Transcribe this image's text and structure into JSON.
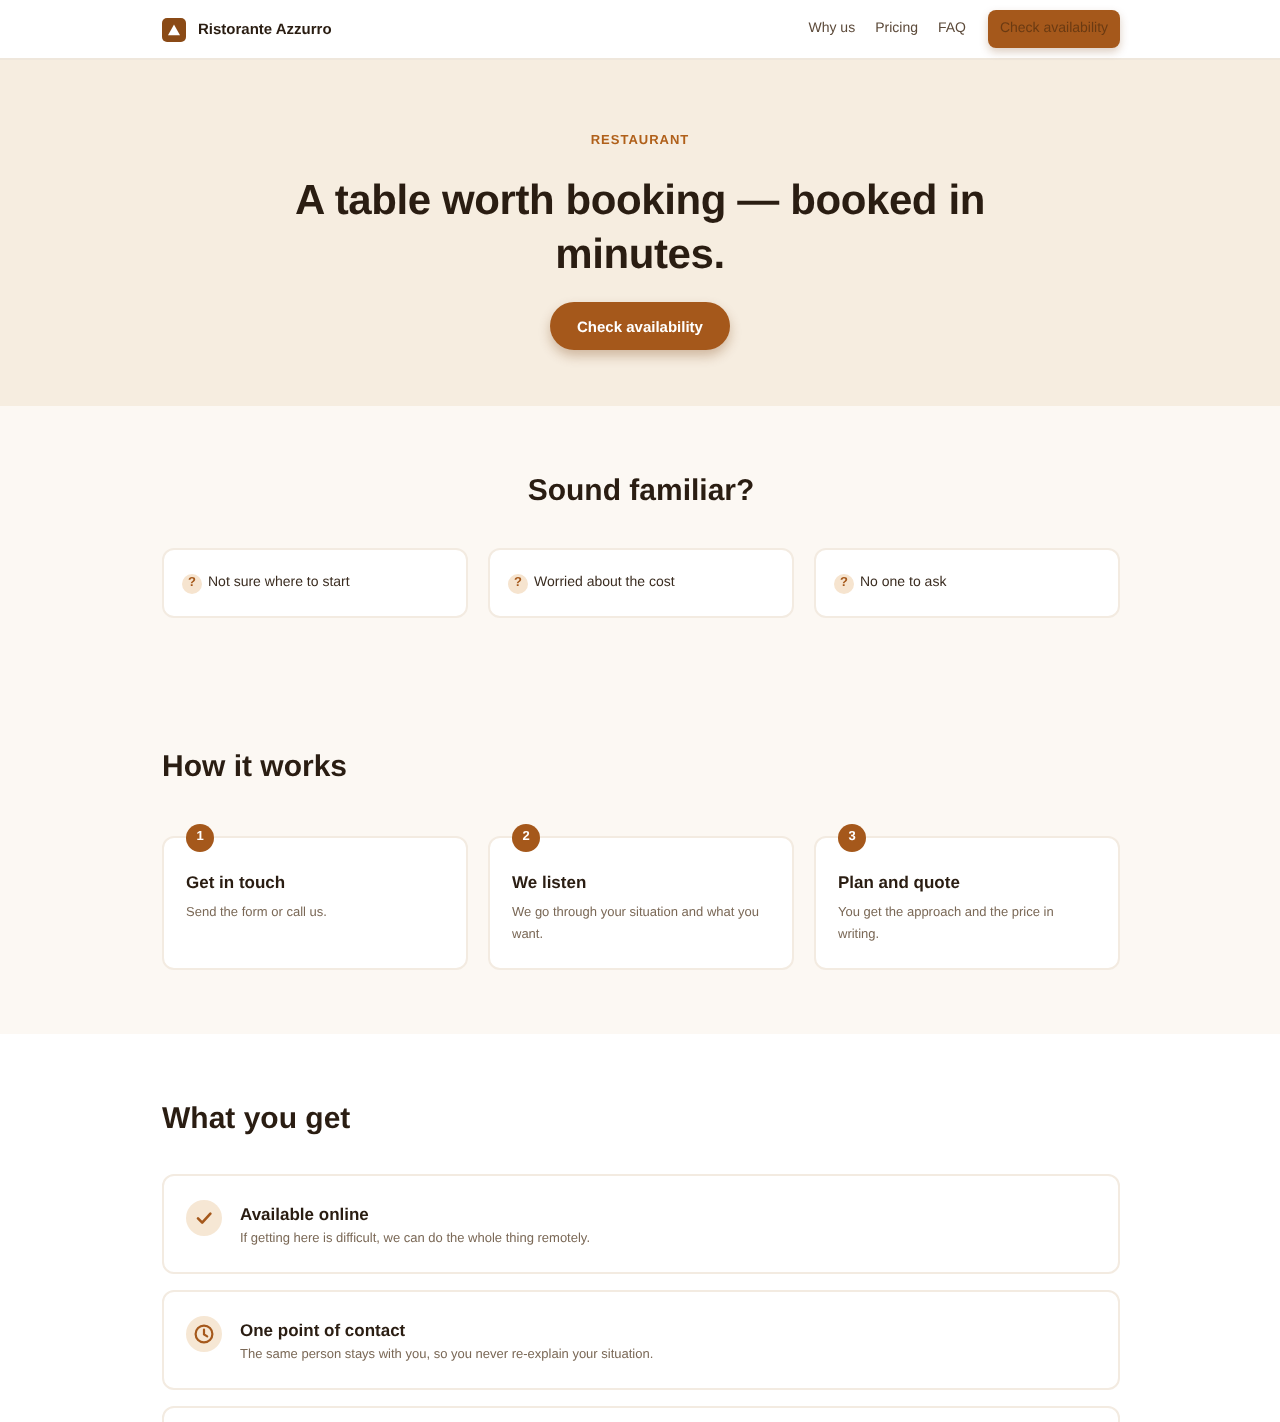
{
  "header": {
    "brand": "Ristorante Azzurro",
    "nav": [
      "Why us",
      "Pricing",
      "FAQ"
    ],
    "cta": "Check availability"
  },
  "hero": {
    "kicker": "RESTAURANT",
    "title": "A table worth booking — booked in minutes.",
    "button": "Check availability"
  },
  "pains": {
    "title": "Sound familiar?",
    "items": [
      {
        "icon": "?",
        "text": "Not sure where to start"
      },
      {
        "icon": "?",
        "text": "Worried about the cost"
      },
      {
        "icon": "?",
        "text": "No one to ask"
      }
    ]
  },
  "steps": {
    "title": "How it works",
    "items": [
      {
        "number": "1",
        "title": "Get in touch",
        "text": "Send the form or call us."
      },
      {
        "number": "2",
        "title": "We listen",
        "text": "We go through your situation and what you want."
      },
      {
        "number": "3",
        "title": "Plan and quote",
        "text": "You get the approach and the price in writing."
      }
    ]
  },
  "benefits": {
    "title": "What you get",
    "items": [
      {
        "kind": "check",
        "title": "Available online",
        "text": "If getting here is difficult, we can do the whole thing remotely."
      },
      {
        "kind": "clock",
        "title": "One point of contact",
        "text": "The same person stays with you, so you never re-explain your situation."
      }
    ]
  }
}
